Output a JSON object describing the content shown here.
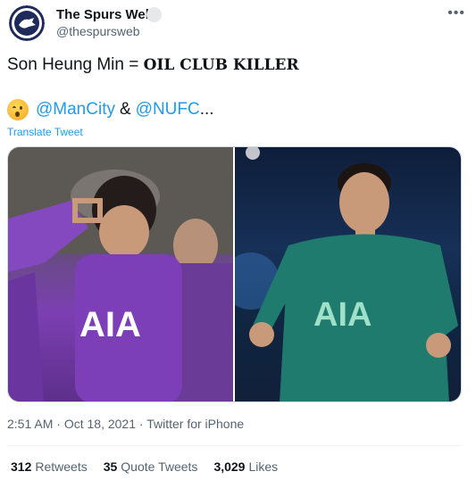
{
  "author": {
    "name": "The Spurs Web",
    "handle": "@thespursweb"
  },
  "tweet": {
    "line1_prefix": "Son Heung Min = ",
    "line1_emphasis": "OIL CLUB KILLER",
    "mention1": "@ManCity",
    "amp": "&",
    "mention2": "@NUFC",
    "ellipsis": "...",
    "translate_label": "Translate Tweet"
  },
  "meta": {
    "time": "2:51 AM",
    "date": "Oct 18, 2021",
    "source": "Twitter for iPhone",
    "separator": "·"
  },
  "stats": {
    "retweets_count": "312",
    "retweets_label": "Retweets",
    "quotes_count": "35",
    "quotes_label": "Quote Tweets",
    "likes_count": "3,029",
    "likes_label": "Likes"
  },
  "icons": {
    "more": "more-icon",
    "emoji": "winking-face-icon",
    "verified": "badge-icon"
  },
  "colors": {
    "accent": "#1d9bf0",
    "text": "#0f1419",
    "muted": "#536471"
  }
}
